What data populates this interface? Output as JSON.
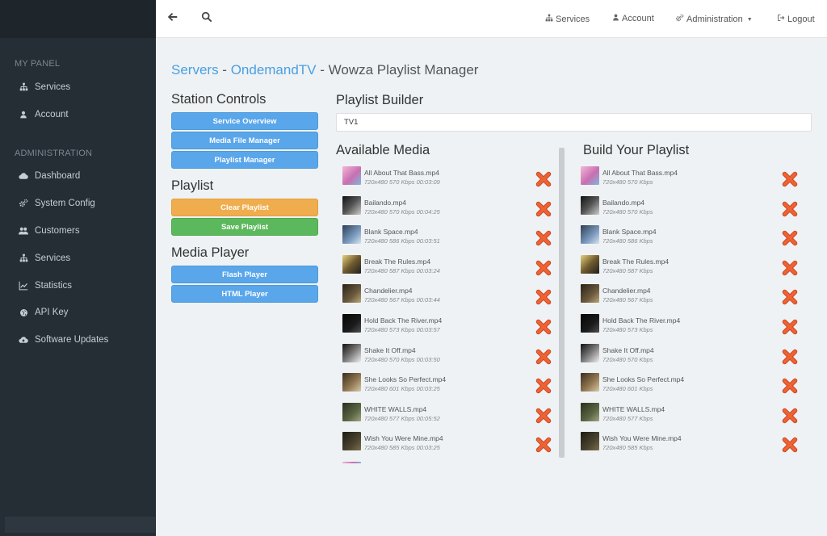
{
  "sidebar": {
    "sections": [
      {
        "title": "MY PANEL",
        "items": [
          {
            "label": "Services",
            "icon": "sitemap-icon"
          },
          {
            "label": "Account",
            "icon": "user-icon"
          }
        ]
      },
      {
        "title": "ADMINISTRATION",
        "items": [
          {
            "label": "Dashboard",
            "icon": "cloud-icon"
          },
          {
            "label": "System Config",
            "icon": "cogs-icon"
          },
          {
            "label": "Customers",
            "icon": "users-icon"
          },
          {
            "label": "Services",
            "icon": "sitemap-icon"
          },
          {
            "label": "Statistics",
            "icon": "line-chart-icon"
          },
          {
            "label": "API Key",
            "icon": "globe-icon"
          },
          {
            "label": "Software Updates",
            "icon": "cloud-upload-icon"
          }
        ]
      }
    ]
  },
  "topbar": {
    "links": [
      {
        "label": "Services",
        "icon": "sitemap-icon"
      },
      {
        "label": "Account",
        "icon": "user-icon"
      },
      {
        "label": "Administration",
        "icon": "cogs-icon",
        "caret": true
      },
      {
        "label": "Logout",
        "icon": "logout-icon"
      }
    ]
  },
  "breadcrumb": {
    "servers": "Servers",
    "sep1": " - ",
    "server": "OndemandTV",
    "sep2": " - ",
    "page": "Wowza Playlist Manager"
  },
  "station_controls": {
    "title": "Station Controls",
    "buttons": [
      "Service Overview",
      "Media File Manager",
      "Playlist Manager"
    ]
  },
  "playlist": {
    "title": "Playlist",
    "clear": "Clear Playlist",
    "save": "Save Playlist"
  },
  "media_player": {
    "title": "Media Player",
    "buttons": [
      "Flash Player",
      "HTML Player"
    ]
  },
  "builder": {
    "title": "Playlist Builder",
    "name_value": "TV1"
  },
  "available": {
    "title": "Available Media",
    "items": [
      {
        "name": "All About That Bass.mp4",
        "info": "720x480 570 Kbps 00:03:09"
      },
      {
        "name": "Bailando.mp4",
        "info": "720x480 570 Kbps 00:04:25"
      },
      {
        "name": "Blank Space.mp4",
        "info": "720x480 586 Kbps 00:03:51"
      },
      {
        "name": "Break The Rules.mp4",
        "info": "720x480 587 Kbps 00:03:24"
      },
      {
        "name": "Chandelier.mp4",
        "info": "720x480 567 Kbps 00:03:44"
      },
      {
        "name": "Hold Back The River.mp4",
        "info": "720x480 573 Kbps 00:03:57"
      },
      {
        "name": "Shake It Off.mp4",
        "info": "720x480 570 Kbps 00:03:50"
      },
      {
        "name": "She Looks So Perfect.mp4",
        "info": "720x480 601 Kbps 00:03:25"
      },
      {
        "name": "WHITE WALLS.mp4",
        "info": "720x480 577 Kbps 00:05:52"
      },
      {
        "name": "Wish You Were Mine.mp4",
        "info": "720x480 585 Kbps 00:03:25"
      }
    ]
  },
  "build": {
    "title": "Build Your Playlist",
    "items": [
      {
        "name": "All About That Bass.mp4",
        "info": "720x480 570 Kbps"
      },
      {
        "name": "Bailando.mp4",
        "info": "720x480 570 Kbps"
      },
      {
        "name": "Blank Space.mp4",
        "info": "720x480 586 Kbps"
      },
      {
        "name": "Break The Rules.mp4",
        "info": "720x480 587 Kbps"
      },
      {
        "name": "Chandelier.mp4",
        "info": "720x480 567 Kbps"
      },
      {
        "name": "Hold Back The River.mp4",
        "info": "720x480 573 Kbps"
      },
      {
        "name": "Shake It Off.mp4",
        "info": "720x480 570 Kbps"
      },
      {
        "name": "She Looks So Perfect.mp4",
        "info": "720x480 601 Kbps"
      },
      {
        "name": "WHITE WALLS.mp4",
        "info": "720x480 577 Kbps"
      },
      {
        "name": "Wish You Were Mine.mp4",
        "info": "720x480 585 Kbps"
      }
    ]
  },
  "colors": {
    "link": "#4a9fe0",
    "primary_button": "#5aa6eb",
    "warning_button": "#f0ad4e",
    "success_button": "#5cb85c",
    "remove_icon": "#e8572a",
    "sidebar_bg": "#252d35"
  }
}
